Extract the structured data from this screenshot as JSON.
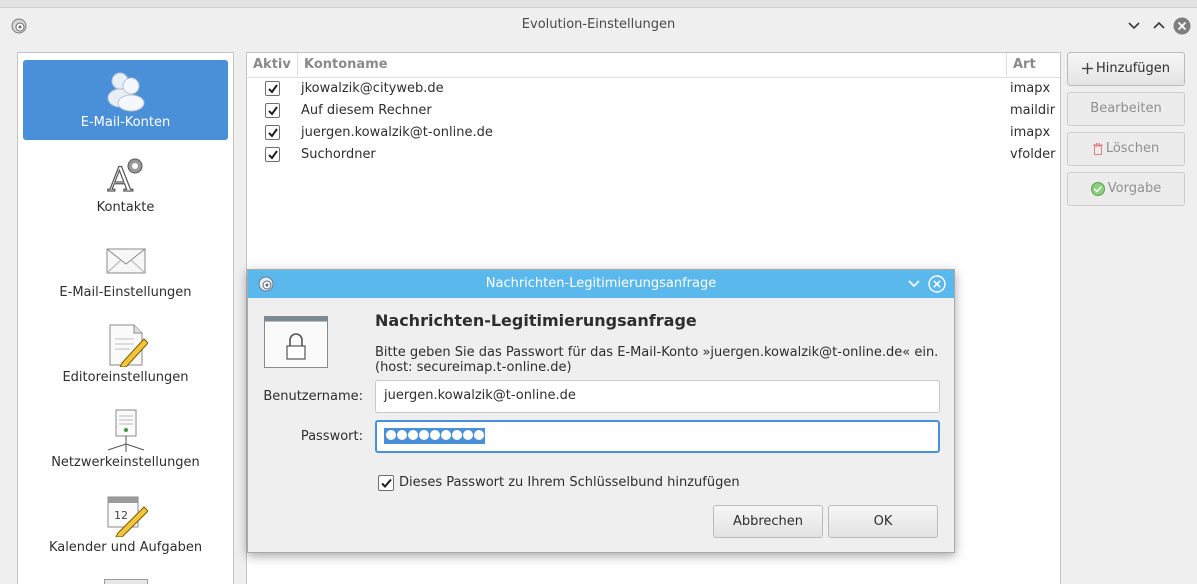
{
  "window": {
    "title": "Evolution-Einstellungen",
    "icons": {
      "app": "gear-app-icon",
      "minimize": "chevron-down-icon",
      "maximize": "chevron-up-icon",
      "close": "close-icon"
    }
  },
  "sidebar": {
    "items": [
      {
        "label": "E-Mail-Konten",
        "icon": "email-accounts-icon",
        "selected": true
      },
      {
        "label": "Kontakte",
        "icon": "contacts-icon",
        "selected": false
      },
      {
        "label": "E-Mail-Einstellungen",
        "icon": "envelope-icon",
        "selected": false
      },
      {
        "label": "Editoreinstellungen",
        "icon": "editor-icon",
        "selected": false
      },
      {
        "label": "Netzwerkeinstellungen",
        "icon": "network-icon",
        "selected": false
      },
      {
        "label": "Kalender und Aufgaben",
        "icon": "calendar-icon",
        "selected": false
      }
    ]
  },
  "accounts": {
    "columns": [
      "Aktiv",
      "Kontoname",
      "Art"
    ],
    "rows": [
      {
        "active": true,
        "name": "jkowalzik@cityweb.de",
        "type": "imapx"
      },
      {
        "active": true,
        "name": "Auf diesem Rechner",
        "type": "maildir"
      },
      {
        "active": true,
        "name": "juergen.kowalzik@t-online.de",
        "type": "imapx"
      },
      {
        "active": true,
        "name": "Suchordner",
        "type": "vfolder"
      }
    ]
  },
  "buttons": {
    "add": "Hinzufügen",
    "edit": "Bearbeiten",
    "delete": "Löschen",
    "default": "Vorgabe"
  },
  "dialog": {
    "title": "Nachrichten-Legitimierungsanfrage",
    "heading": "Nachrichten-Legitimierungsanfrage",
    "message_line1": "Bitte geben Sie das Passwort für das E-Mail-Konto »juergen.kowalzik@t-online.de« ein.",
    "message_line2": "(host: secureimap.t-online.de)",
    "username_label": "Benutzername:",
    "username_value": "juergen.kowalzik@t-online.de",
    "password_label": "Passwort:",
    "password_length": 9,
    "save_checkbox_label": "Dieses Passwort zu Ihrem Schlüsselbund hinzufügen",
    "save_checked": true,
    "cancel": "Abbrechen",
    "ok": "OK"
  },
  "colors": {
    "selection": "#4a90d9",
    "dialog_titlebar": "#5bb8ed"
  }
}
